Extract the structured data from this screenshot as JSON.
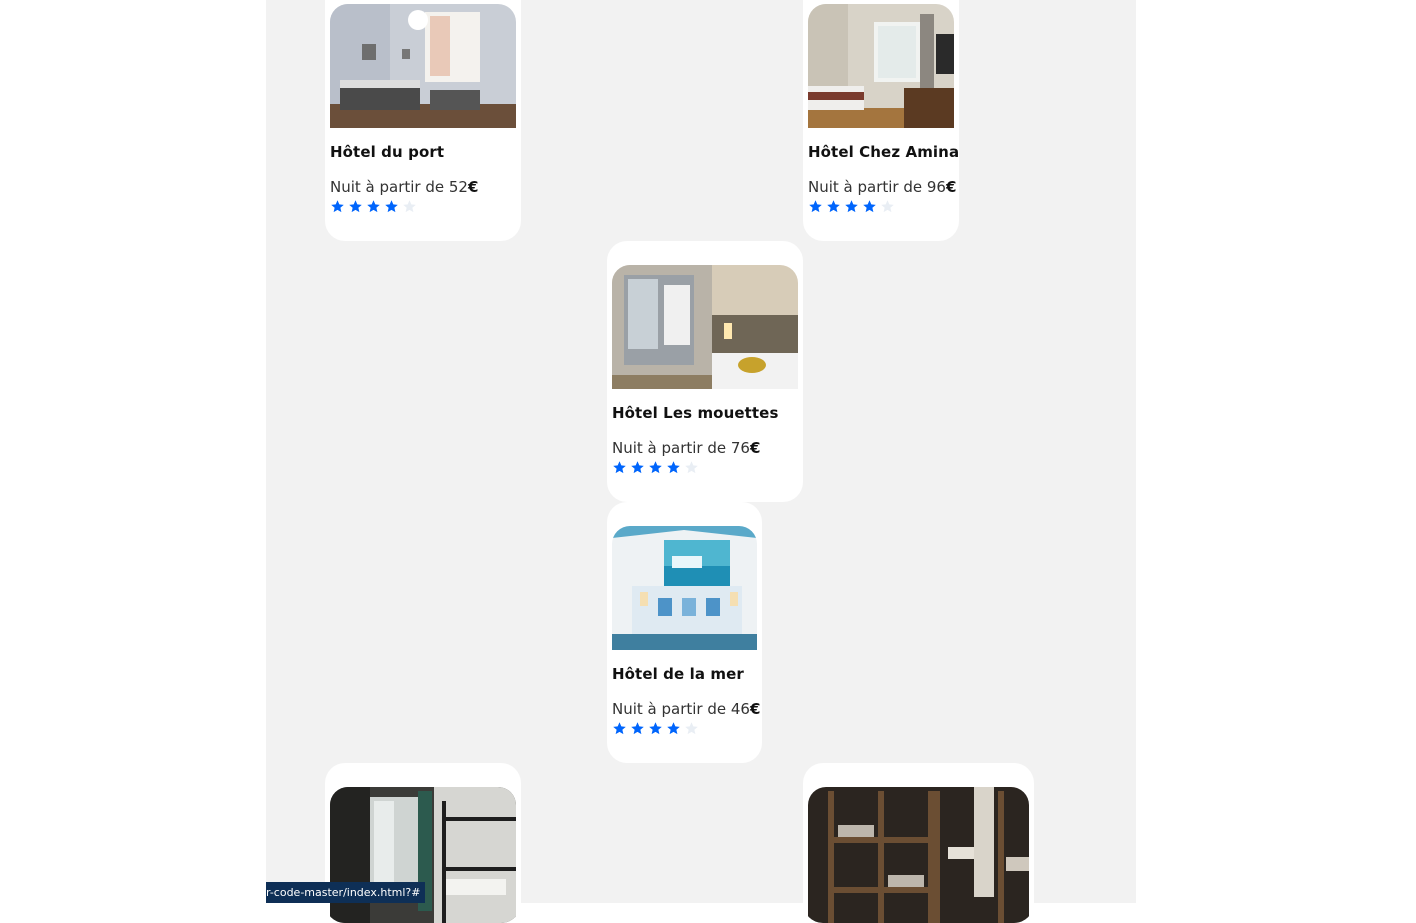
{
  "hotels": [
    {
      "name": "Hôtel du port",
      "price_prefix": "Nuit à partir de ",
      "price": "52",
      "currency": "€",
      "rating": 4,
      "max_rating": 5
    },
    {
      "name": "Hôtel Chez Amina",
      "price_prefix": "Nuit à partir de ",
      "price": "96",
      "currency": "€",
      "rating": 4,
      "max_rating": 5
    },
    {
      "name": "Hôtel Les mouettes",
      "price_prefix": "Nuit à partir de ",
      "price": "76",
      "currency": "€",
      "rating": 4,
      "max_rating": 5
    },
    {
      "name": "Hôtel de la mer",
      "price_prefix": "Nuit à partir de ",
      "price": "46",
      "currency": "€",
      "rating": 4,
      "max_rating": 5
    }
  ],
  "colors": {
    "page_background": "#f2f2f2",
    "card_background": "#ffffff",
    "star_filled": "#0065fc",
    "star_empty": "#e9eef4",
    "status_bar": "#0e2f56"
  },
  "icons": {
    "star": "star-icon"
  },
  "status_bar": {
    "url": "r-code-master/index.html?#"
  }
}
